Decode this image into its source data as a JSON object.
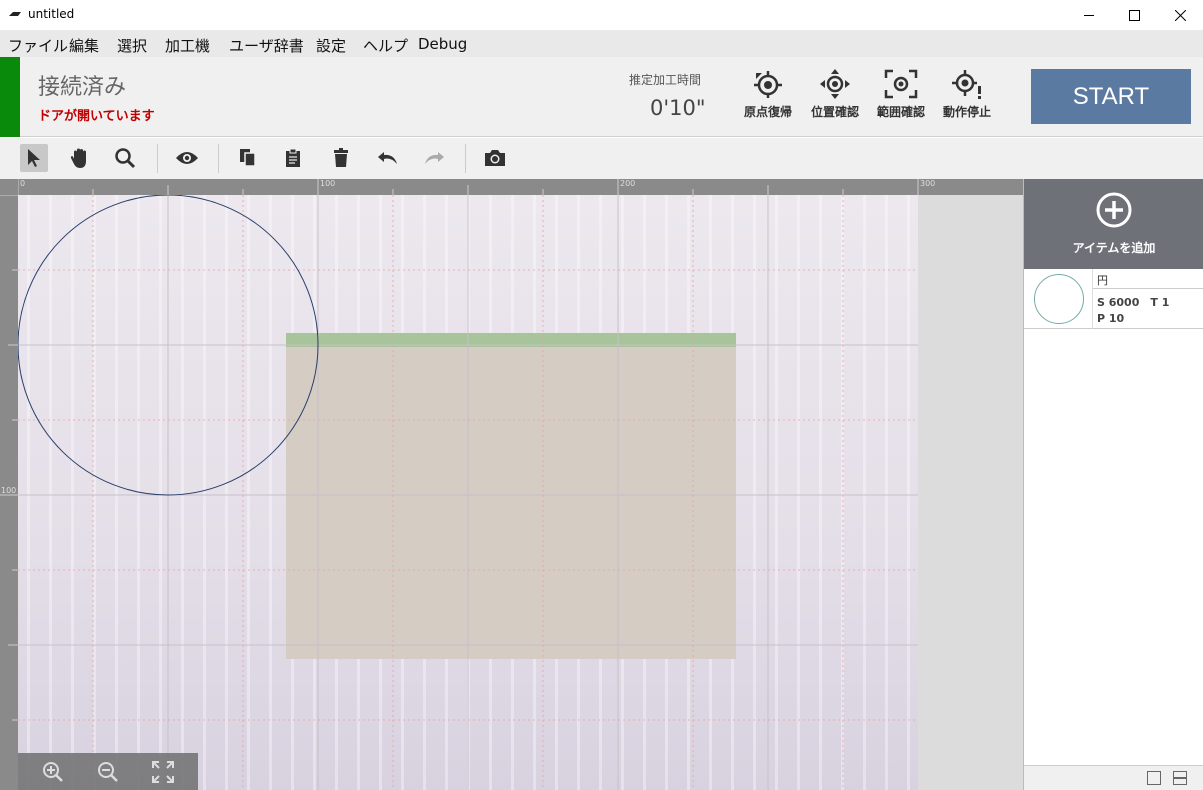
{
  "window": {
    "title": "untitled"
  },
  "menu": [
    "ファイル",
    "編集",
    "選択",
    "加工機",
    "ユーザ辞書",
    "設定",
    "ヘルプ",
    "Debug"
  ],
  "status": {
    "connection": "接続済み",
    "door_warning": "ドアが開いています",
    "connection_color": "#0a8a0a"
  },
  "estimate": {
    "label": "推定加工時間",
    "value": "0'10\""
  },
  "actions": [
    "原点復帰",
    "位置確認",
    "範囲確認",
    "動作停止"
  ],
  "start_button": {
    "label": "START",
    "color": "#5a7aa2"
  },
  "toolbar": [
    "select-arrow-icon",
    "hand-pan-icon",
    "zoom-search-icon",
    "eye-preview-icon",
    "copy-icon",
    "paste-clipboard-icon",
    "delete-trash-icon",
    "undo-icon",
    "redo-icon",
    "camera-icon"
  ],
  "rulers": {
    "top": [
      "0",
      "100",
      "200",
      "300"
    ],
    "left": [
      "100"
    ]
  },
  "right_panel": {
    "add_item_label": "アイテムを追加",
    "items": [
      {
        "name": "円",
        "params_line1": "S 6000　T 1",
        "params_line2": "P 10"
      }
    ]
  }
}
